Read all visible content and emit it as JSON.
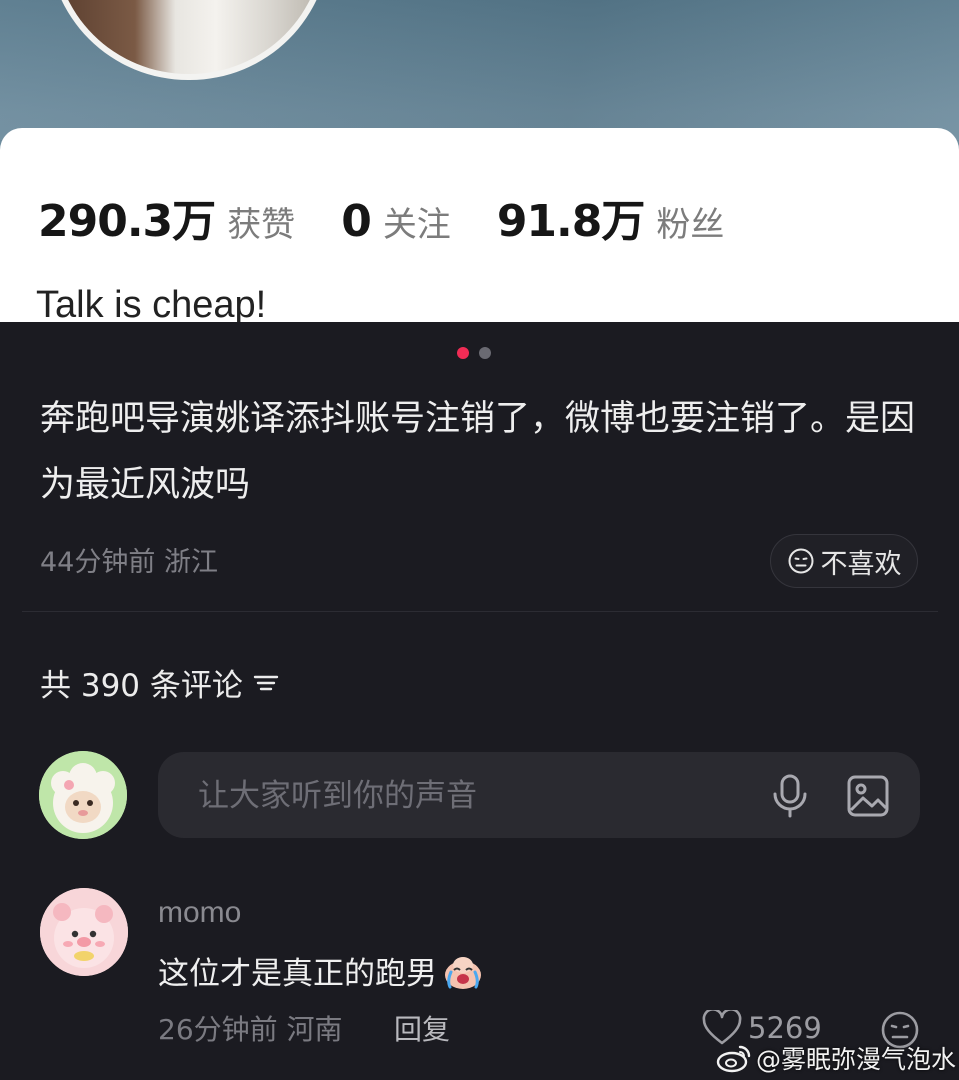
{
  "profile": {
    "stats": [
      {
        "value": "290.3万",
        "label": "获赞"
      },
      {
        "value": "0",
        "label": "关注"
      },
      {
        "value": "91.8万",
        "label": "粉丝"
      }
    ],
    "bio": "Talk is cheap!"
  },
  "post": {
    "pager": {
      "pages": 2,
      "active": 1
    },
    "text": "奔跑吧导演姚译添抖账号注销了，微博也要注销了。是因为最近风波吗",
    "meta": "44分钟前 浙江",
    "dislike_label": "不喜欢"
  },
  "comments": {
    "count_label": "共 390 条评论",
    "composer_placeholder": "让大家听到你的声音",
    "items": [
      {
        "user": "momo",
        "text": "这位才是真正的跑男",
        "meta": "26分钟前 河南",
        "reply_label": "回复",
        "likes": "5269"
      }
    ]
  },
  "watermark": "@雾眠弥漫气泡水",
  "colors": {
    "accent": "#f02c55",
    "background": "#1b1b21",
    "input_bg": "#2a2a30"
  },
  "icons": [
    "sort-icon",
    "mic-icon",
    "image-icon",
    "heart-icon",
    "dislike-face-icon",
    "crying-emoji-icon",
    "weibo-logo-icon"
  ]
}
